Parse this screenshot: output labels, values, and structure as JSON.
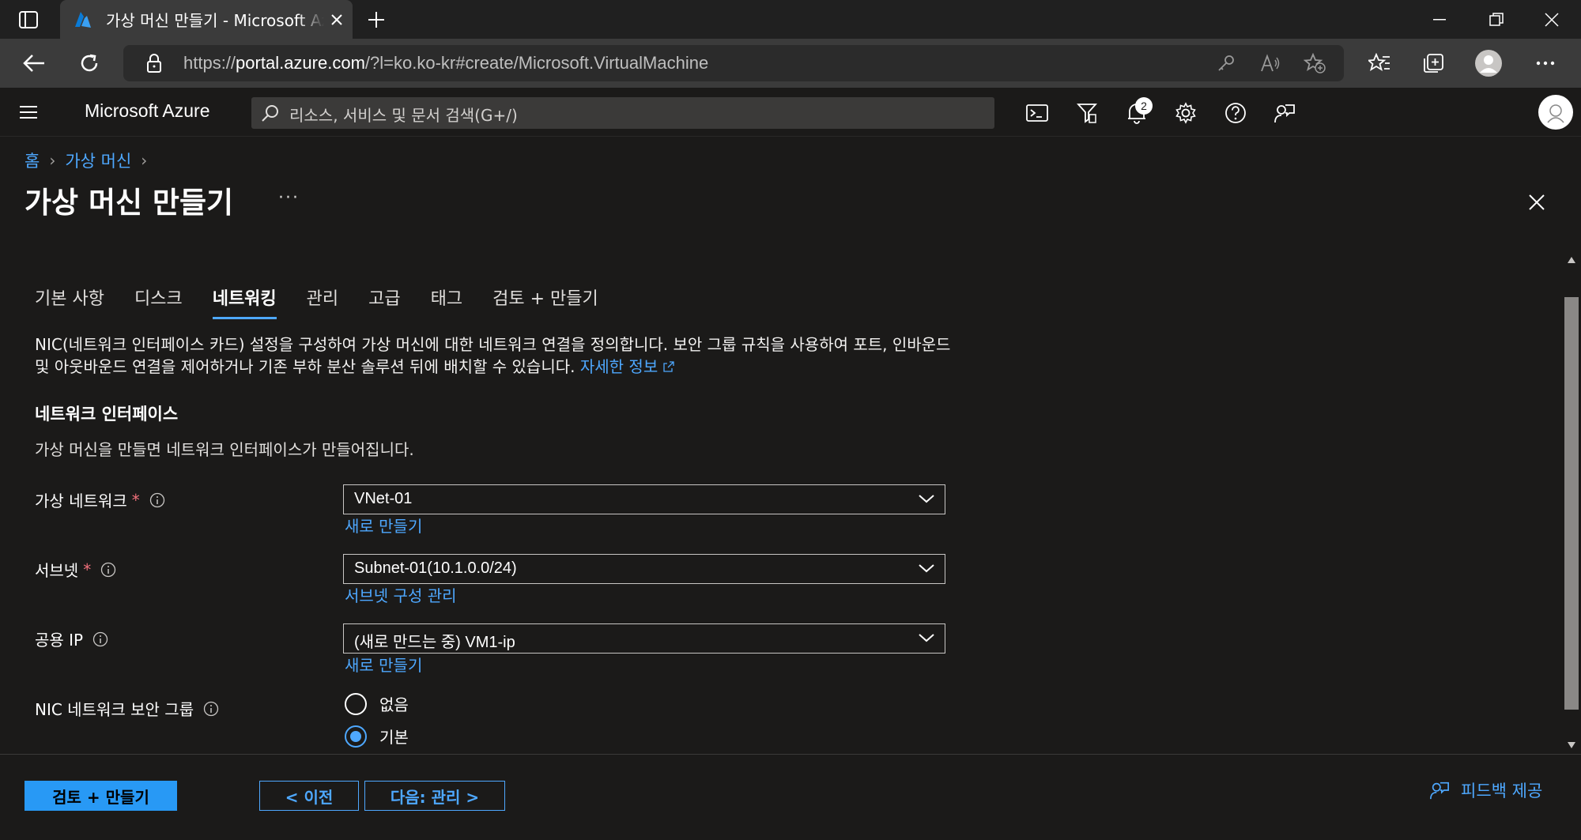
{
  "browser": {
    "tab_title": "가상 머신 만들기 - Microsoft Azure",
    "url_prefix": "https://",
    "url_host": "portal.azure.com",
    "url_rest": "/?l=ko.ko-kr#create/Microsoft.VirtualMachine"
  },
  "header": {
    "brand": "Microsoft Azure",
    "search_placeholder": "리소스, 서비스 및 문서 검색(G+/)",
    "notification_count": "2"
  },
  "breadcrumb": {
    "home": "홈",
    "vm": "가상 머신"
  },
  "page": {
    "title": "가상 머신 만들기",
    "more": "···"
  },
  "tabs": [
    "기본 사항",
    "디스크",
    "네트워킹",
    "관리",
    "고급",
    "태그",
    "검토 + 만들기"
  ],
  "description": {
    "text": "NIC(네트워크 인터페이스 카드) 설정을 구성하여 가상 머신에 대한 네트워크 연결을 정의합니다. 보안 그룹 규칙을 사용하여 포트, 인바운드 및 아웃바운드 연결을 제어하거나 기존 부하 분산 솔루션 뒤에 배치할 수 있습니다.",
    "link": "자세한 정보"
  },
  "section": {
    "title": "네트워크 인터페이스",
    "subtitle": "가상 머신을 만들면 네트워크 인터페이스가 만들어집니다."
  },
  "fields": {
    "vnet": {
      "label": "가상 네트워크",
      "required": "*",
      "value": "VNet-01",
      "link": "새로 만들기"
    },
    "subnet": {
      "label": "서브넷",
      "required": "*",
      "value": "Subnet-01(10.1.0.0/24)",
      "link": "서브넷 구성 관리"
    },
    "public_ip": {
      "label": "공용 IP",
      "value": "(새로 만드는 중) VM1-ip",
      "link": "새로 만들기"
    },
    "nsg": {
      "label": "NIC 네트워크 보안 그룹",
      "options": [
        "없음",
        "기본"
      ],
      "selected": "기본"
    }
  },
  "footer": {
    "review_create": "검토 + 만들기",
    "previous": "< 이전",
    "next": "다음: 관리 >",
    "feedback": "피드백 제공"
  },
  "colors": {
    "accent": "#2899f5",
    "link": "#4ea8ff",
    "background": "#1b1a19"
  }
}
